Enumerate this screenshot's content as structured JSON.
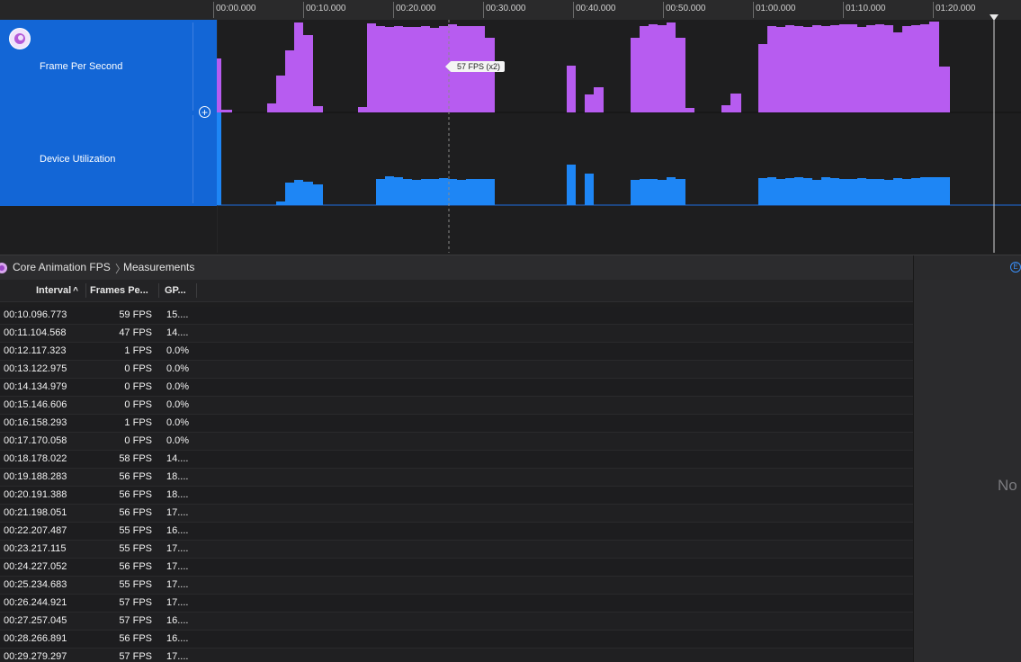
{
  "ruler": {
    "ticks": [
      "00:00.000",
      "00:10.000",
      "00:20.000",
      "00:30.000",
      "00:40.000",
      "00:50.000",
      "01:00.000",
      "01:10.000",
      "01:20.000"
    ]
  },
  "tracks": [
    {
      "label": "Frame Per Second",
      "color": "#b75cf0"
    },
    {
      "label": "Device Utilization",
      "color": "#1e86f5"
    }
  ],
  "tooltip": "57 FPS (x2)",
  "colors": {
    "track_header": "#1366d6",
    "fps": "#b75cf0",
    "utilization": "#1e86f5"
  },
  "breadcrumb": {
    "instrument": "Core Animation FPS",
    "view": "Measurements"
  },
  "table": {
    "columns": [
      "Interval",
      "Frames Pe...",
      "GP..."
    ],
    "sort_indicator": "^",
    "rows": [
      [
        "00:10.096.773",
        "59 FPS",
        "15...."
      ],
      [
        "00:11.104.568",
        "47 FPS",
        "14...."
      ],
      [
        "00:12.117.323",
        "1 FPS",
        "0.0%"
      ],
      [
        "00:13.122.975",
        "0 FPS",
        "0.0%"
      ],
      [
        "00:14.134.979",
        "0 FPS",
        "0.0%"
      ],
      [
        "00:15.146.606",
        "0 FPS",
        "0.0%"
      ],
      [
        "00:16.158.293",
        "1 FPS",
        "0.0%"
      ],
      [
        "00:17.170.058",
        "0 FPS",
        "0.0%"
      ],
      [
        "00:18.178.022",
        "58 FPS",
        "14...."
      ],
      [
        "00:19.188.283",
        "56 FPS",
        "18...."
      ],
      [
        "00:20.191.388",
        "56 FPS",
        "18...."
      ],
      [
        "00:21.198.051",
        "56 FPS",
        "17...."
      ],
      [
        "00:22.207.487",
        "55 FPS",
        "16...."
      ],
      [
        "00:23.217.115",
        "55 FPS",
        "17...."
      ],
      [
        "00:24.227.052",
        "56 FPS",
        "17...."
      ],
      [
        "00:25.234.683",
        "55 FPS",
        "17...."
      ],
      [
        "00:26.244.921",
        "57 FPS",
        "17...."
      ],
      [
        "00:27.257.045",
        "57 FPS",
        "16...."
      ],
      [
        "00:28.266.891",
        "56 FPS",
        "16...."
      ],
      [
        "00:29.279.297",
        "57 FPS",
        "17...."
      ]
    ]
  },
  "inspector": {
    "empty_text": "No"
  }
}
